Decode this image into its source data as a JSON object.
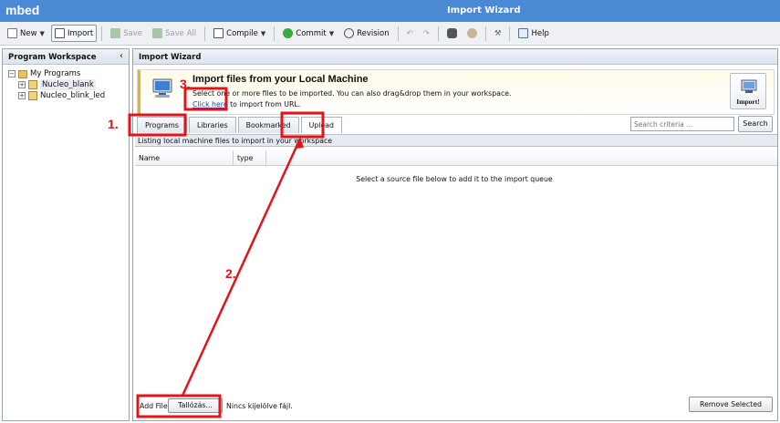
{
  "titlebar": {
    "brand": "mbed",
    "window_title": "Import Wizard"
  },
  "toolbar": {
    "items": [
      {
        "label": "New",
        "icon": "new-file-icon",
        "dropdown": true,
        "enabled": true
      },
      {
        "label": "Import",
        "icon": "import-icon",
        "pressed": true,
        "enabled": true
      },
      {
        "label": "Save",
        "icon": "save-icon",
        "enabled": false
      },
      {
        "label": "Save All",
        "icon": "save-all-icon",
        "enabled": false
      },
      {
        "label": "Compile",
        "icon": "compile-icon",
        "dropdown": true,
        "enabled": true
      },
      {
        "label": "Commit",
        "icon": "commit-icon",
        "dropdown": true,
        "enabled": true
      },
      {
        "label": "Revision",
        "icon": "revision-icon",
        "enabled": true
      },
      {
        "label": "Help",
        "icon": "help-icon",
        "enabled": true
      }
    ]
  },
  "workspace": {
    "title": "Program Workspace",
    "collapse_glyph": "‹",
    "root": "My Programs",
    "programs": [
      "Nucleo_blank",
      "Nucleo_blink_led"
    ]
  },
  "wizard": {
    "title": "Import Wizard",
    "banner": {
      "heading": "Import files from your Local Machine",
      "description": "Select one or more files to be imported. You can also drag&drop them in your workspace.",
      "link_text": "Click here",
      "link_suffix": " to import from URL."
    },
    "import_button_label": "Import!",
    "tabs": [
      "Programs",
      "Libraries",
      "Bookmarked",
      "Upload"
    ],
    "active_tab": "Upload",
    "search": {
      "placeholder": "Search criteria ..."
    },
    "search_button": "Search",
    "listing_text": "Listing local machine files to import in your workspace",
    "columns": [
      "Name",
      "type"
    ],
    "empty_message": "Select a source file below to add it to the import queue",
    "add_file_label": "Add File",
    "browse_label": "Tallózás...",
    "no_file_text": "Nincs kijelölve fájl.",
    "remove_label": "Remove Selected"
  },
  "annotations": {
    "color": "#e0141a",
    "labels": [
      "1.",
      "2.",
      "3."
    ]
  }
}
